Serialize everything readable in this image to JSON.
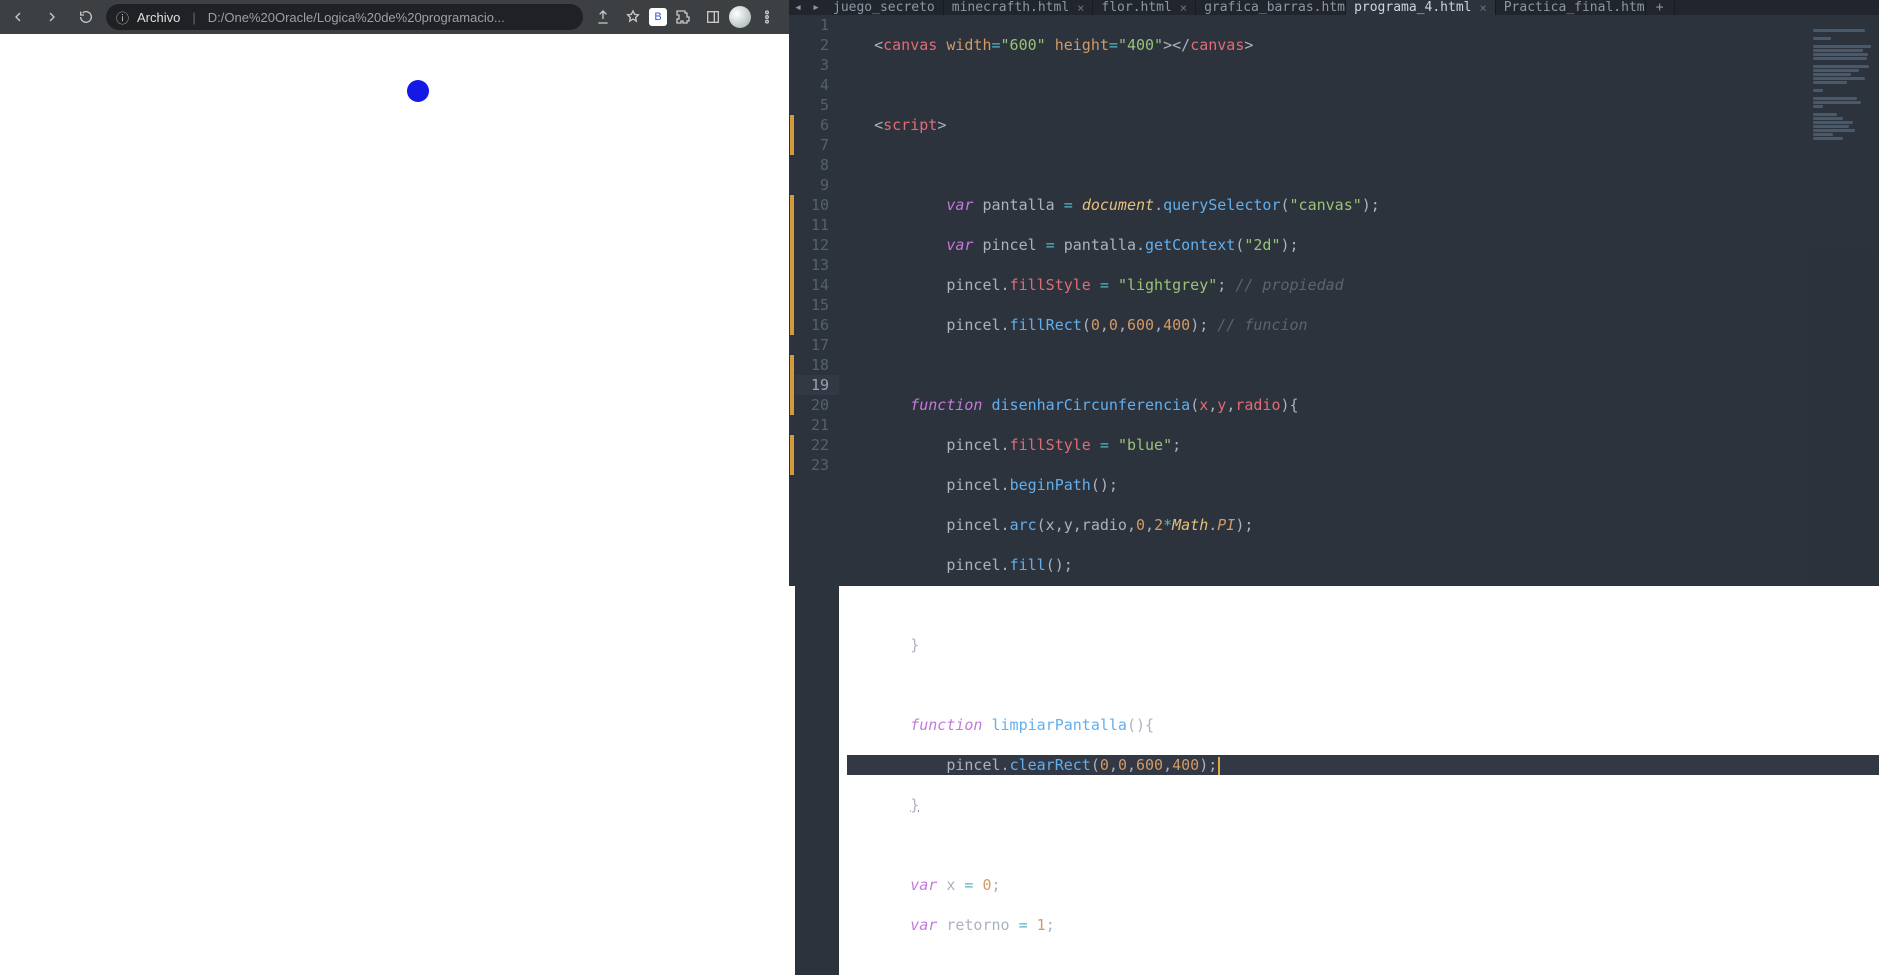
{
  "browser": {
    "address_label": "Archivo",
    "address_url": "D:/One%20Oracle/Logica%20de%20programacio..."
  },
  "editor": {
    "tabs": [
      {
        "label": "juego_secreto"
      },
      {
        "label": "minecrafth.html"
      },
      {
        "label": "flor.html"
      },
      {
        "label": "grafica_barras.html"
      },
      {
        "label": "programa_4.html"
      },
      {
        "label": "Practica_final.html"
      }
    ],
    "active_tab_index": 4,
    "current_line": 19,
    "line_numbers": [
      "1",
      "2",
      "3",
      "4",
      "5",
      "6",
      "7",
      "8",
      "9",
      "10",
      "11",
      "12",
      "13",
      "14",
      "15",
      "16",
      "17",
      "18",
      "19",
      "20",
      "21",
      "22",
      "23"
    ],
    "modified_lines": [
      6,
      7,
      10,
      11,
      12,
      13,
      14,
      15,
      16,
      18,
      19,
      20,
      22,
      23
    ],
    "code": {
      "l1": {
        "a": "<",
        "b": "canvas",
        "c": " ",
        "d": "width",
        "e": "=",
        "f": "\"600\"",
        "g": " ",
        "h": "height",
        "i": "=",
        "j": "\"400\"",
        "k": "></",
        "l": "canvas",
        "m": ">"
      },
      "l3": {
        "a": "<",
        "b": "script",
        "c": ">"
      },
      "l5": {
        "a": "var",
        "b": " pantalla ",
        "c": "=",
        "d": " ",
        "e": "document",
        "f": ".",
        "g": "querySelector",
        "h": "(",
        "i": "\"canvas\"",
        "j": ");"
      },
      "l6": {
        "a": "var",
        "b": " pincel ",
        "c": "=",
        "d": " pantalla.",
        "e": "getContext",
        "f": "(",
        "g": "\"2d\"",
        "h": ");"
      },
      "l7": {
        "a": "pincel.",
        "b": "fillStyle",
        "c": " ",
        "d": "=",
        "e": " ",
        "f": "\"lightgrey\"",
        "g": "; ",
        "h": "// propiedad"
      },
      "l8": {
        "a": "pincel.",
        "b": "fillRect",
        "c": "(",
        "d": "0",
        "e": ",",
        "f": "0",
        "g": ",",
        "h": "600",
        "i": ",",
        "j": "400",
        "k": "); ",
        "l": "// funcion"
      },
      "l10": {
        "a": "function",
        "b": " ",
        "c": "disenharCircunferencia",
        "d": "(",
        "e": "x",
        "f": ",",
        "g": "y",
        "h": ",",
        "i": "radio",
        "j": "){"
      },
      "l11": {
        "a": "pincel.",
        "b": "fillStyle",
        "c": " ",
        "d": "=",
        "e": " ",
        "f": "\"blue\"",
        "g": ";"
      },
      "l12": {
        "a": "pincel.",
        "b": "beginPath",
        "c": "();"
      },
      "l13": {
        "a": "pincel.",
        "b": "arc",
        "c": "(x,y,radio,",
        "d": "0",
        "e": ",",
        "f": "2",
        "g": "*",
        "h": "Math",
        "i": ".",
        "j": "PI",
        "k": ");"
      },
      "l14": {
        "a": "pincel.",
        "b": "fill",
        "c": "();"
      },
      "l16": {
        "a": "}"
      },
      "l18": {
        "a": "function",
        "b": " ",
        "c": "limpiarPantalla",
        "d": "(){"
      },
      "l19": {
        "a": "pincel.",
        "b": "clearRect",
        "c": "(",
        "d": "0",
        "e": ",",
        "f": "0",
        "g": ",",
        "h": "600",
        "i": ",",
        "j": "400",
        "k": ");"
      },
      "l20": {
        "a": "}"
      },
      "l22": {
        "a": "var",
        "b": " x ",
        "c": "=",
        "d": " ",
        "e": "0",
        "f": ";"
      },
      "l23": {
        "a": "var",
        "b": " retorno ",
        "c": "=",
        "d": " ",
        "e": "1",
        "f": ";"
      }
    }
  }
}
